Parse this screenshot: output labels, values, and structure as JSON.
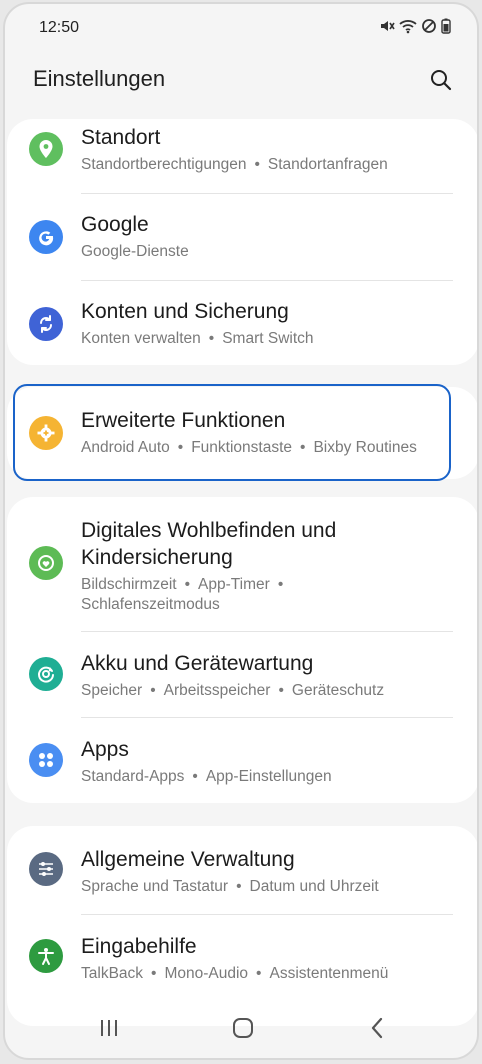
{
  "status": {
    "time": "12:50"
  },
  "header": {
    "title": "Einstellungen"
  },
  "cards": {
    "top": [
      {
        "title": "Standort",
        "sub": [
          "Standortberechtigungen",
          "Standortanfragen"
        ],
        "icon": "location-icon",
        "color": "#5fbf5f"
      },
      {
        "title": "Google",
        "sub": [
          "Google-Dienste"
        ],
        "icon": "google-icon",
        "color": "#3d86f0"
      },
      {
        "title": "Konten und Sicherung",
        "sub": [
          "Konten verwalten",
          "Smart Switch"
        ],
        "icon": "sync-icon",
        "color": "#3f63d6"
      }
    ],
    "advanced": {
      "title": "Erweiterte Funktionen",
      "sub": [
        "Android Auto",
        "Funktionstaste",
        "Bixby Routines"
      ],
      "icon": "gear-plus-icon",
      "color": "#f5b433"
    },
    "wellbeing": [
      {
        "title_line1": "Digitales Wohlbefinden und",
        "title_line2": "Kindersicherung",
        "sub_line1": [
          "Bildschirmzeit",
          "App-Timer",
          ""
        ],
        "sub_line2": "Schlafenszeitmodus",
        "icon": "wellbeing-icon",
        "color": "#5dbb55"
      },
      {
        "title": "Akku und Gerätewartung",
        "sub": [
          "Speicher",
          "Arbeitsspeicher",
          "Geräteschutz"
        ],
        "icon": "device-care-icon",
        "color": "#1fae94"
      },
      {
        "title": "Apps",
        "sub": [
          "Standard-Apps",
          "App-Einstellungen"
        ],
        "icon": "apps-icon",
        "color": "#4a8ef2"
      }
    ],
    "general": [
      {
        "title": "Allgemeine Verwaltung",
        "sub": [
          "Sprache und Tastatur",
          "Datum und Uhrzeit"
        ],
        "icon": "sliders-icon",
        "color": "#5a6a82"
      },
      {
        "title": "Eingabehilfe",
        "sub": [
          "TalkBack",
          "Mono-Audio",
          "Assistentenmenü"
        ],
        "icon": "accessibility-icon",
        "color": "#2e9b40"
      }
    ]
  },
  "highlight_color": "#1a63c9"
}
